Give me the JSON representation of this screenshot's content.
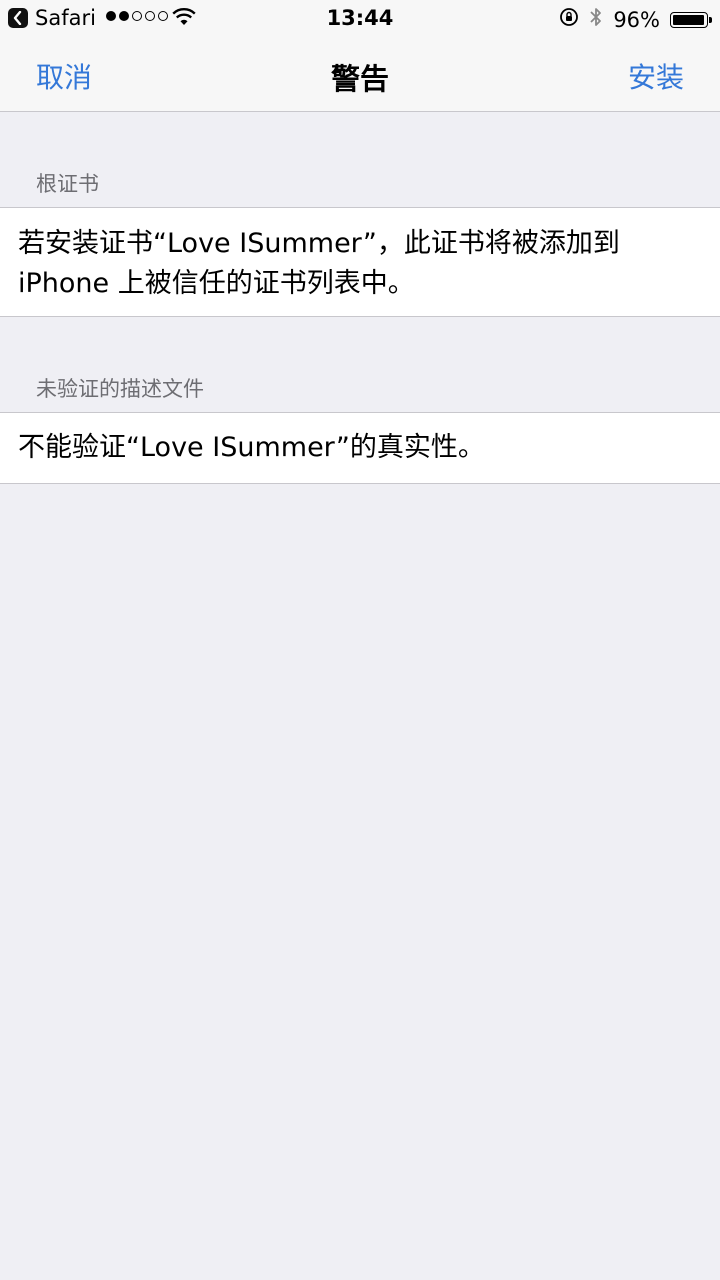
{
  "status_bar": {
    "back_app": "Safari",
    "time": "13:44",
    "battery_text": "96%",
    "battery_level": 0.96,
    "signal_bars": 2,
    "signal_total": 5
  },
  "nav": {
    "cancel_label": "取消",
    "title": "警告",
    "install_label": "安装",
    "accent_color": "#3478d8"
  },
  "sections": {
    "root_cert": {
      "header": "根证书",
      "body": "若安装证书“Love ISummer”，此证书将被添加到iPhone 上被信任的证书列表中。"
    },
    "unverified_profile": {
      "header": "未验证的描述文件",
      "body": "不能验证“Love ISummer”的真实性。"
    }
  }
}
